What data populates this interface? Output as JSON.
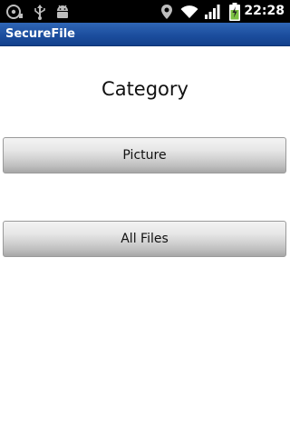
{
  "status_bar": {
    "time": "22:28",
    "icons": [
      "sd-card-icon",
      "usb-icon",
      "android-debug-icon",
      "location-icon",
      "wifi-icon",
      "signal-icon",
      "battery-charging-icon"
    ]
  },
  "app": {
    "title": "SecureFile"
  },
  "main": {
    "heading": "Category",
    "buttons": [
      {
        "label": "Picture"
      },
      {
        "label": "All Files"
      }
    ]
  }
}
